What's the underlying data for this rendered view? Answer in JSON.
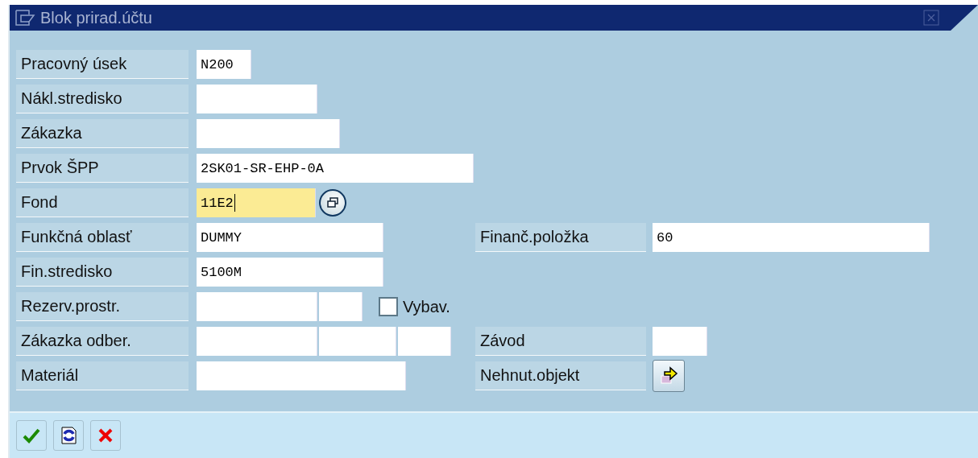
{
  "window": {
    "title": "Blok prirad.účtu"
  },
  "rows": [
    {
      "label": "Pracovný úsek",
      "fields": [
        {
          "value": "N200",
          "focused": false
        }
      ]
    },
    {
      "label": "Nákl.stredisko",
      "fields": [
        {
          "focused": false
        }
      ]
    },
    {
      "label": "Zákazka",
      "fields": [
        {
          "focused": false
        }
      ]
    },
    {
      "label": "Prvok ŠPP",
      "fields": [
        {
          "value": "2SK01-SR-EHP-0A",
          "focused": false
        }
      ]
    },
    {
      "label": "Fond",
      "fields": [
        {
          "value": "11E2",
          "focused": true
        }
      ],
      "kind": "lookup"
    },
    {
      "label": "Funkčná oblasť",
      "fields": [
        {
          "value": "DUMMY",
          "focused": false
        }
      ],
      "right": {
        "label": "Finanč.položka",
        "kind": "field",
        "value": "60"
      }
    },
    {
      "label": "Fin.stredisko",
      "fields": [
        {
          "value": "5100M",
          "focused": false
        }
      ]
    },
    {
      "label": "Rezerv.prostr.",
      "fields": [
        {
          "focused": false
        },
        {
          "focused": false
        }
      ],
      "checkbox": {
        "label": "Vybav.",
        "checked": false
      }
    },
    {
      "label": "Zákazka odber.",
      "fields": [
        {
          "focused": false
        },
        {
          "focused": false
        },
        {
          "focused": false
        }
      ],
      "right": {
        "label": "Závod",
        "kind": "field"
      }
    },
    {
      "label": "Materiál",
      "fields": [
        {
          "focused": false
        }
      ],
      "right": {
        "label": "Nehnut.objekt",
        "kind": "button"
      }
    }
  ],
  "toolbar": [
    {
      "kind": "confirm"
    },
    {
      "kind": "refresh"
    },
    {
      "kind": "cancel"
    }
  ]
}
